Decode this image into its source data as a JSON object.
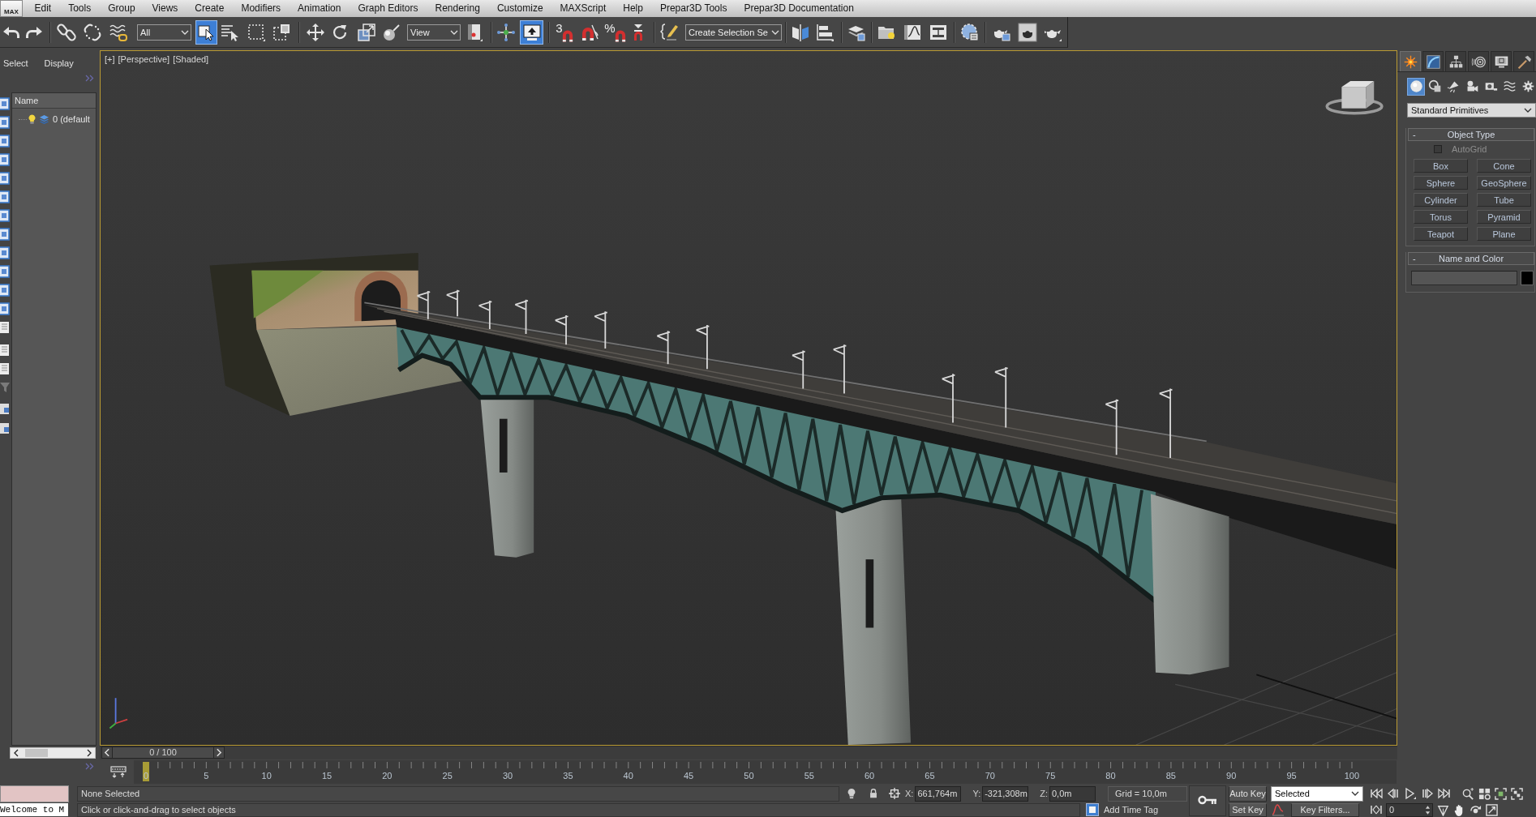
{
  "menu_bar": {
    "logo": "MAX",
    "items": [
      "Edit",
      "Tools",
      "Group",
      "Views",
      "Create",
      "Modifiers",
      "Animation",
      "Graph Editors",
      "Rendering",
      "Customize",
      "MAXScript",
      "Help",
      "Prepar3D Tools",
      "Prepar3D Documentation"
    ]
  },
  "toolbar": {
    "selection_filter": "All",
    "select_object": {
      "selected": true
    },
    "reference_coordinate_system": "View",
    "keyboard_shortcut_override": {
      "on": true
    },
    "snap_toggle": "3",
    "percent_snap": "%",
    "named_selection_set": "Create Selection Se"
  },
  "scene_explorer": {
    "menus": [
      "Select",
      "Display"
    ],
    "column": "Name",
    "layers": [
      {
        "name": "0 (default"
      }
    ]
  },
  "viewport": {
    "active": true,
    "labels": [
      "[+]",
      "[Perspective]",
      "[Shaded]"
    ]
  },
  "command_panel": {
    "tabs": [
      {
        "selected": true
      },
      {
        "selected": false
      },
      {
        "selected": false
      },
      {
        "selected": false
      },
      {
        "selected": false
      },
      {
        "selected": false
      }
    ],
    "categories": [
      {
        "selected": true
      },
      {
        "selected": false
      },
      {
        "selected": false
      },
      {
        "selected": false
      },
      {
        "selected": false
      },
      {
        "selected": false
      },
      {
        "selected": false
      }
    ],
    "category_dropdown": "Standard Primitives",
    "object_type": {
      "sign": "-",
      "title": "Object Type",
      "autogrid": {
        "label": "AutoGrid",
        "checked": false
      },
      "buttons": [
        "Box",
        "Cone",
        "Sphere",
        "GeoSphere",
        "Cylinder",
        "Tube",
        "Torus",
        "Pyramid",
        "Teapot",
        "Plane"
      ]
    },
    "name_and_color": {
      "sign": "-",
      "title": "Name and Color",
      "color": "#000000"
    }
  },
  "time_slider": {
    "label": "0 / 100",
    "level": 0
  },
  "track_bar": {
    "labels": [
      "0",
      "5",
      "10",
      "15",
      "20",
      "25",
      "30",
      "35",
      "40",
      "45",
      "50",
      "55",
      "60",
      "65",
      "70",
      "75",
      "80",
      "85",
      "90",
      "95",
      "100"
    ],
    "level": 0
  },
  "maxscript_listener": {
    "output": "Welcome to M"
  },
  "status_bar": {
    "selection": "None Selected",
    "prompt": "Click or click-and-drag to select objects",
    "coordinates": [
      {
        "axis": "X:",
        "value": "661,764m"
      },
      {
        "axis": "Y:",
        "value": "-321,308m"
      },
      {
        "axis": "Z:",
        "value": "0,0m"
      }
    ],
    "grid": "Grid = 10,0m",
    "add_time_tag": "Add Time Tag",
    "auto_key": {
      "label": "Auto Key",
      "on": false
    },
    "key_mode": "Selected",
    "set_key": "Set Key",
    "key_filters": "Key Filters...",
    "current_frame": "0"
  }
}
